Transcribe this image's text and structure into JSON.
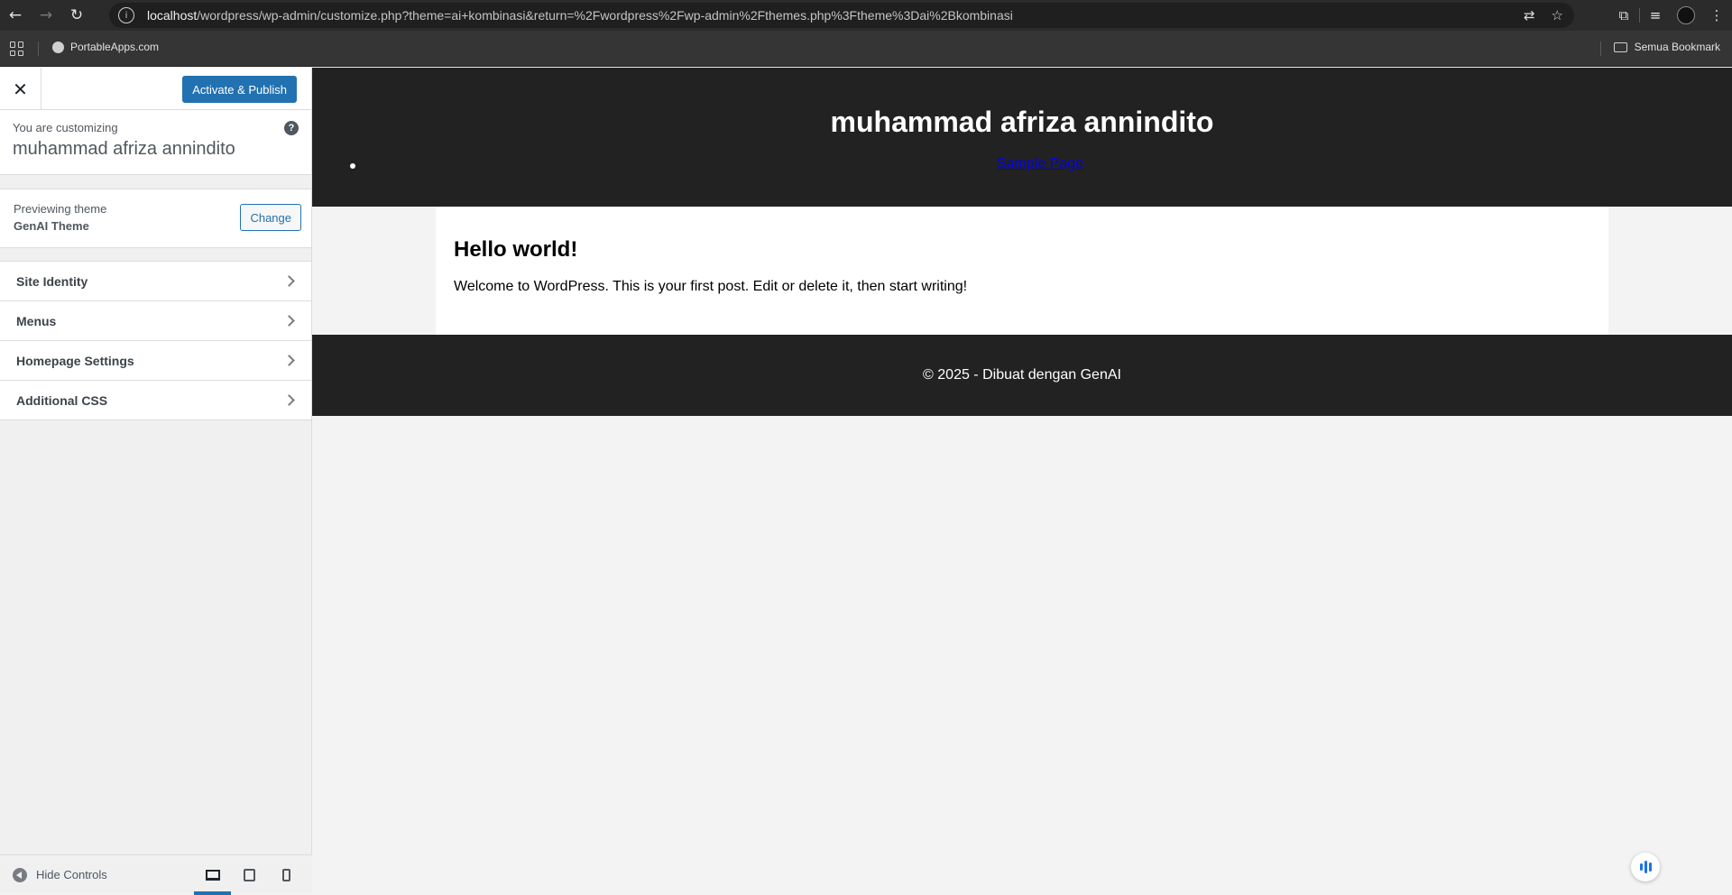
{
  "browser": {
    "url_host": "localhost",
    "url_path": "/wordpress/wp-admin/customize.php?theme=ai+kombinasi&return=%2Fwordpress%2Fwp-admin%2Fthemes.php%3Ftheme%3Dai%2Bkombinasi",
    "bookmarks": [
      {
        "label": "PortableApps.com"
      }
    ],
    "all_bookmarks_label": "Semua Bookmark",
    "icons": {
      "back": "arrow-left-icon",
      "forward": "arrow-right-icon",
      "reload": "reload-icon",
      "translate": "translate-icon",
      "bookmark_star": "star-icon",
      "extensions": "puzzle-icon",
      "media": "media-icon",
      "menu": "kebab-icon"
    }
  },
  "customizer": {
    "publish_label": "Activate & Publish",
    "customizing_label": "You are customizing",
    "site_name": "muhammad afriza annindito",
    "previewing_label": "Previewing theme",
    "theme_name": "GenAI Theme",
    "change_label": "Change",
    "sections": [
      {
        "label": "Site Identity"
      },
      {
        "label": "Menus"
      },
      {
        "label": "Homepage Settings"
      },
      {
        "label": "Additional CSS"
      }
    ],
    "hide_controls_label": "Hide Controls",
    "active_device": "desktop",
    "accent_color": "#2271b1"
  },
  "preview": {
    "site_title": "muhammad afriza annindito",
    "nav_items": [
      {
        "label": "Sample Page"
      }
    ],
    "post_title": "Hello world!",
    "post_body": "Welcome to WordPress. This is your first post. Edit or delete it, then start writing!",
    "footer_text": "© 2025 - Dibuat dengan GenAI",
    "header_bg": "#222222"
  }
}
